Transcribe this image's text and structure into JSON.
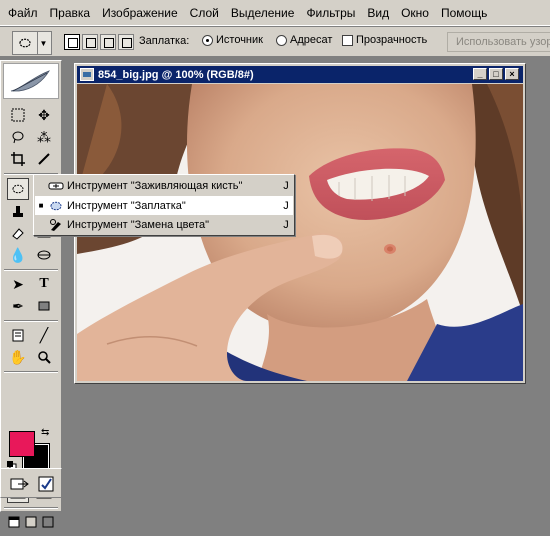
{
  "menu": [
    "Файл",
    "Правка",
    "Изображение",
    "Слой",
    "Выделение",
    "Фильтры",
    "Вид",
    "Окно",
    "Помощь"
  ],
  "options": {
    "patch_label": "Заплатка:",
    "source_label": "Источник",
    "dest_label": "Адресат",
    "transparent_label": "Прозрачность",
    "use_pattern_label": "Использовать узор",
    "patch_mode": "source"
  },
  "document": {
    "title": "854_big.jpg @ 100% (RGB/8#)",
    "min_label": "_",
    "max_label": "□",
    "close_label": "×"
  },
  "flyout": {
    "items": [
      {
        "label": "Инструмент \"Заживляющая кисть\"",
        "key": "J",
        "selected": false,
        "icon": "healing-brush-icon"
      },
      {
        "label": "Инструмент \"Заплатка\"",
        "key": "J",
        "selected": true,
        "icon": "patch-icon"
      },
      {
        "label": "Инструмент \"Замена цвета\"",
        "key": "J",
        "selected": false,
        "icon": "color-replacement-icon"
      }
    ],
    "bullet": "■"
  },
  "colors": {
    "foreground": "#e8185a",
    "background": "#000000",
    "title_bar": "#0a246a",
    "panel": "#d4d0c8"
  }
}
